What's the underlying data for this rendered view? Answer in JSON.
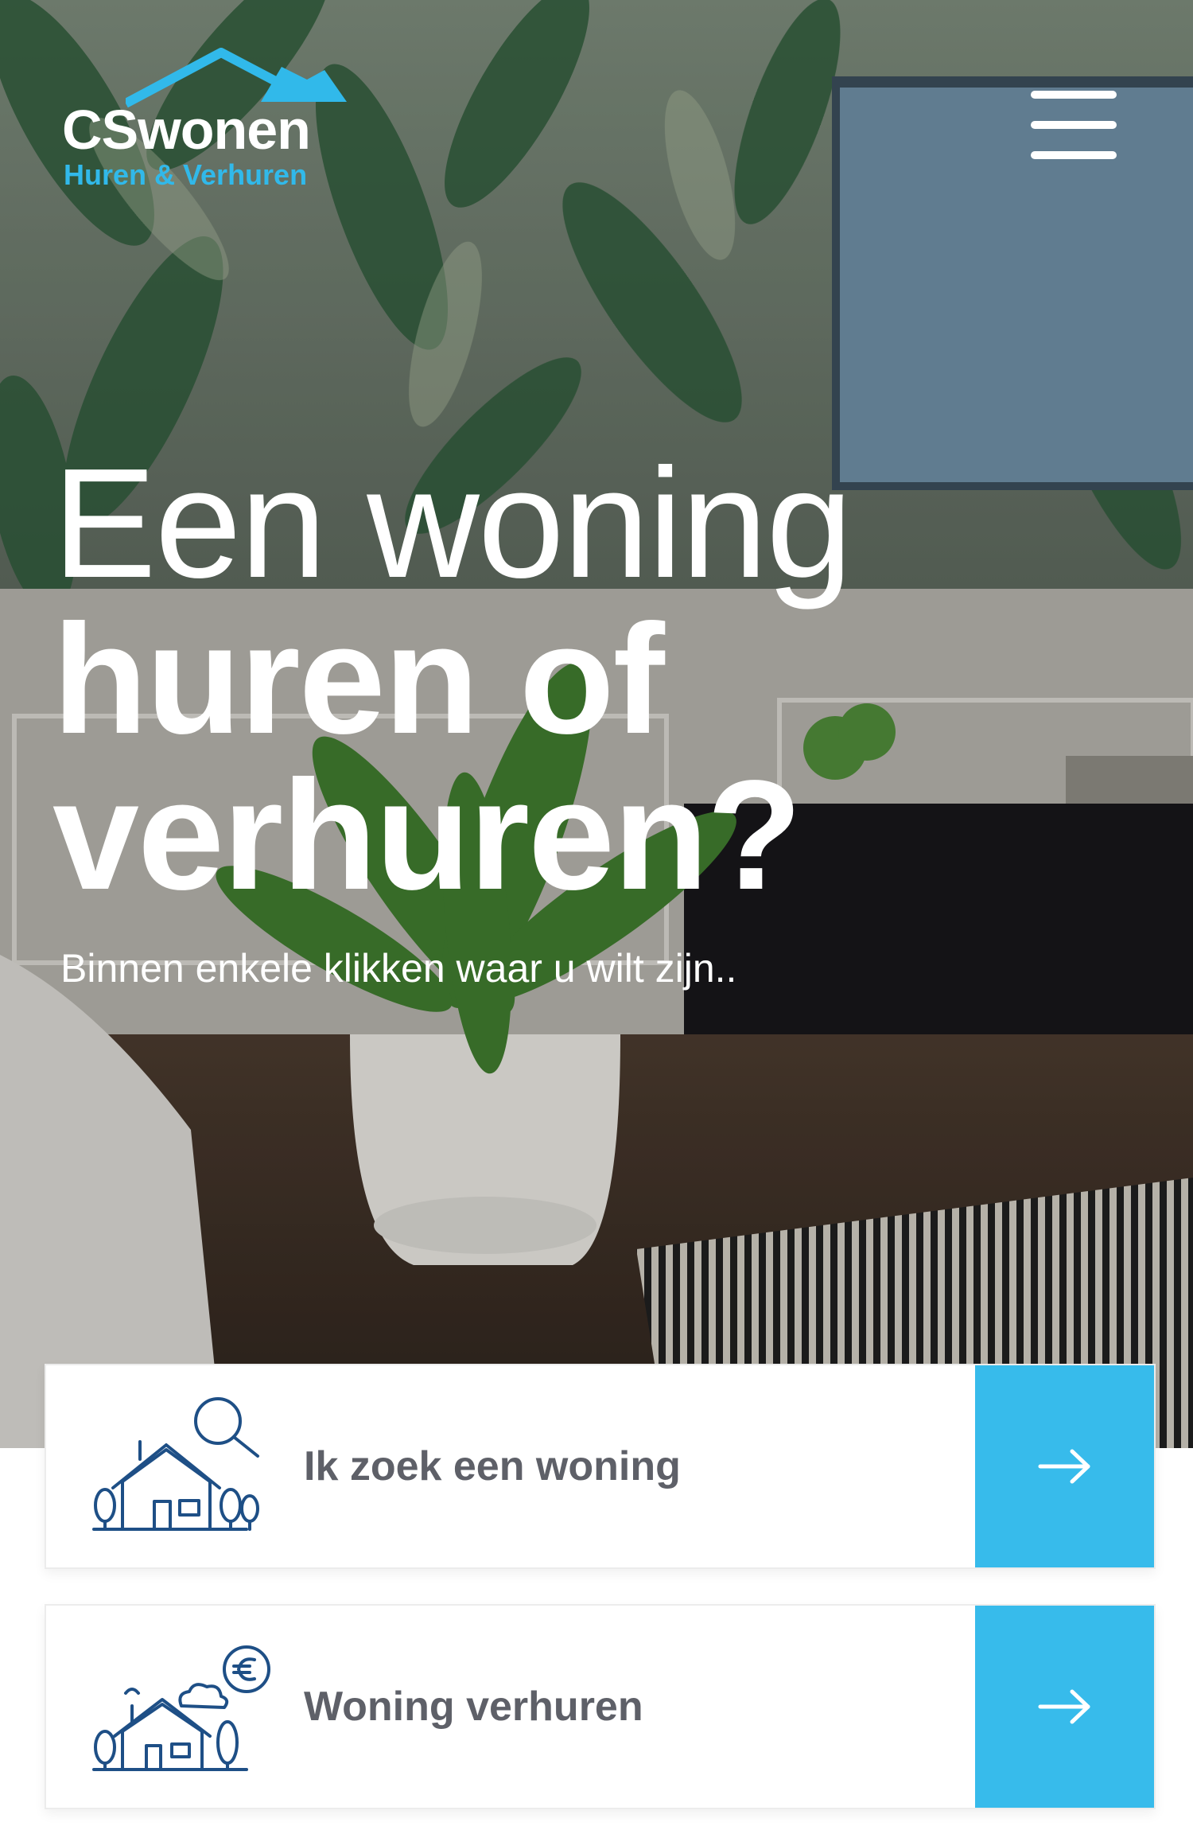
{
  "brand": {
    "name": "CSwonen",
    "tagline": "Huren & Verhuren",
    "accent_color": "#37bbeb",
    "tagline_color": "#31b9ea"
  },
  "header": {
    "menu_icon": "hamburger-menu-icon"
  },
  "hero": {
    "headline_light": "Een woning",
    "headline_bold_line1": "huren of",
    "headline_bold_line2": "verhuren?",
    "subtitle": "Binnen enkele klikken waar u wilt zijn.."
  },
  "options": [
    {
      "label": "Ik zoek een woning",
      "icon": "house-search-icon",
      "arrow_icon": "arrow-right-icon"
    },
    {
      "label": "Woning verhuren",
      "icon": "house-euro-icon",
      "arrow_icon": "arrow-right-icon"
    }
  ]
}
